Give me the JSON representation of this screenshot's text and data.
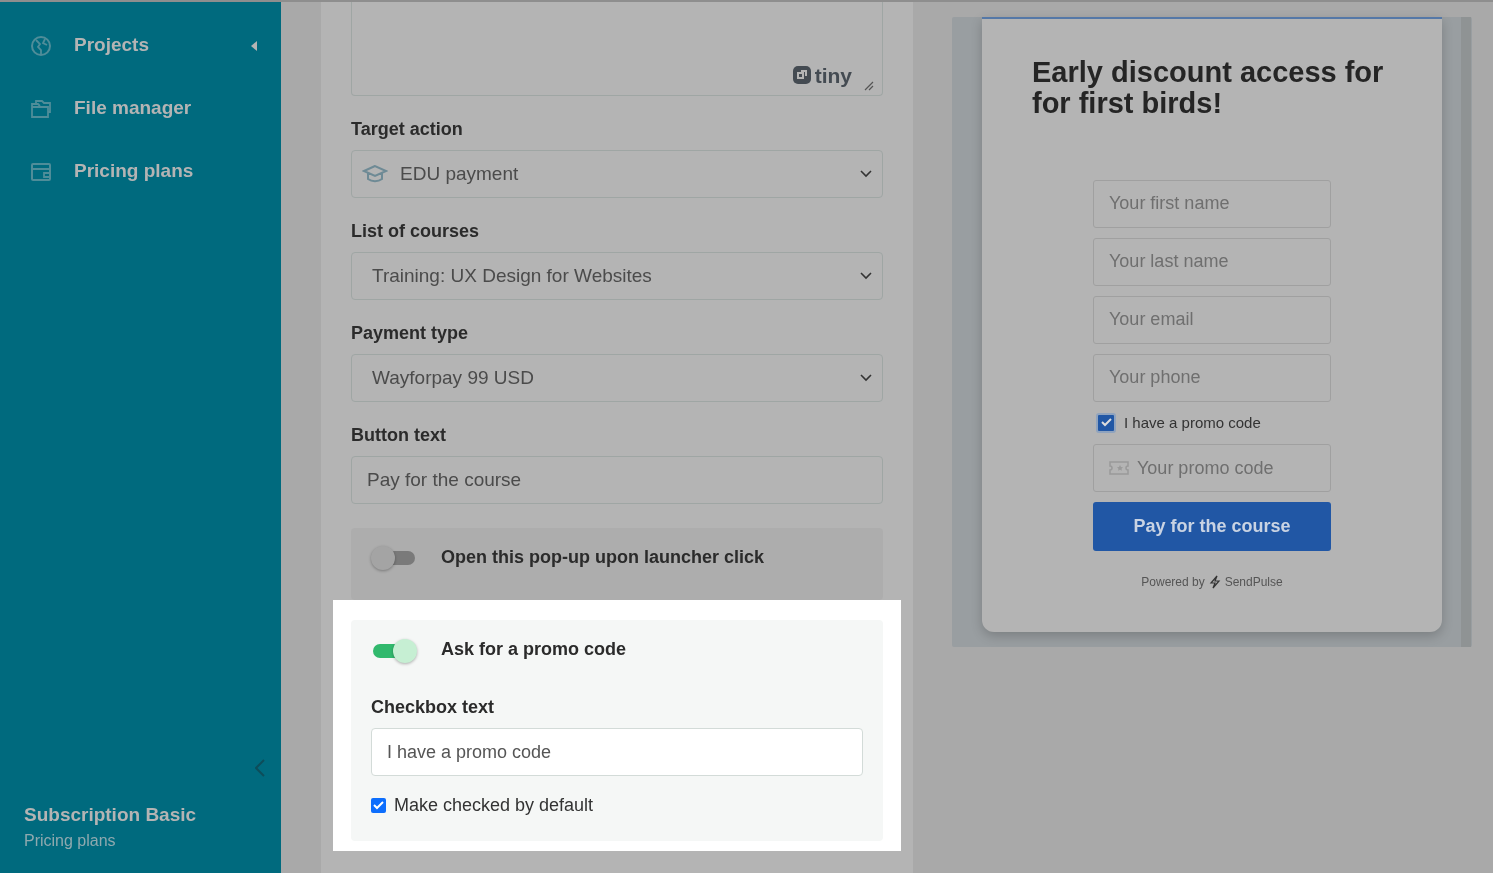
{
  "sidebar": {
    "items": [
      {
        "label": "Projects",
        "submenu": true
      },
      {
        "label": "File manager",
        "submenu": false
      },
      {
        "label": "Pricing plans",
        "submenu": false
      }
    ],
    "footer": {
      "plan": "Subscription Basic",
      "subtitle": "Pricing plans"
    }
  },
  "form": {
    "editor": {
      "brand": "tiny"
    },
    "fields": [
      {
        "kind": "select",
        "label": "Target action",
        "value": "EDU payment",
        "icon": true
      },
      {
        "kind": "select",
        "label": "List of courses",
        "value": "Training: UX Design for Websites",
        "icon": false
      },
      {
        "kind": "select",
        "label": "Payment type",
        "value": "Wayforpay 99 USD",
        "icon": false
      },
      {
        "kind": "input",
        "label": "Button text",
        "value": "Pay for the course",
        "icon": false
      }
    ],
    "toggles": [
      {
        "label": "Open this pop-up upon launcher click",
        "on": false,
        "highlighted": false
      },
      {
        "label": "Ask for a promo code",
        "on": true,
        "highlighted": true,
        "text_label": "Checkbox text",
        "text_value": "I have a promo code",
        "default": {
          "label": "Make checked by default",
          "checked": true
        }
      }
    ]
  },
  "preview": {
    "title": "Early discount access for for first birds!",
    "placeholders": [
      "Your first name",
      "Your last name",
      "Your email",
      "Your phone"
    ],
    "promo_checkbox": {
      "label": "I have a promo code",
      "checked": true
    },
    "promo_placeholder": "Your promo code",
    "button": "Pay for the course",
    "powered_by": "Powered by",
    "brand": "SendPulse"
  }
}
